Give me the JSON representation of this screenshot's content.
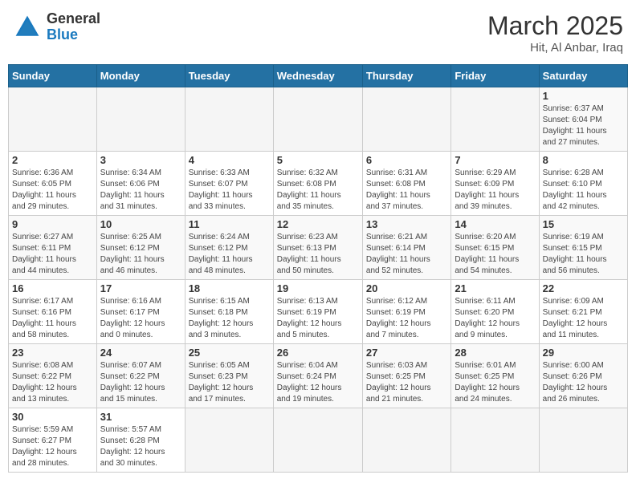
{
  "header": {
    "logo_general": "General",
    "logo_blue": "Blue",
    "title": "March 2025",
    "subtitle": "Hit, Al Anbar, Iraq"
  },
  "days_of_week": [
    "Sunday",
    "Monday",
    "Tuesday",
    "Wednesday",
    "Thursday",
    "Friday",
    "Saturday"
  ],
  "weeks": [
    [
      {
        "day": "",
        "info": ""
      },
      {
        "day": "",
        "info": ""
      },
      {
        "day": "",
        "info": ""
      },
      {
        "day": "",
        "info": ""
      },
      {
        "day": "",
        "info": ""
      },
      {
        "day": "",
        "info": ""
      },
      {
        "day": "1",
        "info": "Sunrise: 6:37 AM\nSunset: 6:04 PM\nDaylight: 11 hours\nand 27 minutes."
      }
    ],
    [
      {
        "day": "2",
        "info": "Sunrise: 6:36 AM\nSunset: 6:05 PM\nDaylight: 11 hours\nand 29 minutes."
      },
      {
        "day": "3",
        "info": "Sunrise: 6:34 AM\nSunset: 6:06 PM\nDaylight: 11 hours\nand 31 minutes."
      },
      {
        "day": "4",
        "info": "Sunrise: 6:33 AM\nSunset: 6:07 PM\nDaylight: 11 hours\nand 33 minutes."
      },
      {
        "day": "5",
        "info": "Sunrise: 6:32 AM\nSunset: 6:08 PM\nDaylight: 11 hours\nand 35 minutes."
      },
      {
        "day": "6",
        "info": "Sunrise: 6:31 AM\nSunset: 6:08 PM\nDaylight: 11 hours\nand 37 minutes."
      },
      {
        "day": "7",
        "info": "Sunrise: 6:29 AM\nSunset: 6:09 PM\nDaylight: 11 hours\nand 39 minutes."
      },
      {
        "day": "8",
        "info": "Sunrise: 6:28 AM\nSunset: 6:10 PM\nDaylight: 11 hours\nand 42 minutes."
      }
    ],
    [
      {
        "day": "9",
        "info": "Sunrise: 6:27 AM\nSunset: 6:11 PM\nDaylight: 11 hours\nand 44 minutes."
      },
      {
        "day": "10",
        "info": "Sunrise: 6:25 AM\nSunset: 6:12 PM\nDaylight: 11 hours\nand 46 minutes."
      },
      {
        "day": "11",
        "info": "Sunrise: 6:24 AM\nSunset: 6:12 PM\nDaylight: 11 hours\nand 48 minutes."
      },
      {
        "day": "12",
        "info": "Sunrise: 6:23 AM\nSunset: 6:13 PM\nDaylight: 11 hours\nand 50 minutes."
      },
      {
        "day": "13",
        "info": "Sunrise: 6:21 AM\nSunset: 6:14 PM\nDaylight: 11 hours\nand 52 minutes."
      },
      {
        "day": "14",
        "info": "Sunrise: 6:20 AM\nSunset: 6:15 PM\nDaylight: 11 hours\nand 54 minutes."
      },
      {
        "day": "15",
        "info": "Sunrise: 6:19 AM\nSunset: 6:15 PM\nDaylight: 11 hours\nand 56 minutes."
      }
    ],
    [
      {
        "day": "16",
        "info": "Sunrise: 6:17 AM\nSunset: 6:16 PM\nDaylight: 11 hours\nand 58 minutes."
      },
      {
        "day": "17",
        "info": "Sunrise: 6:16 AM\nSunset: 6:17 PM\nDaylight: 12 hours\nand 0 minutes."
      },
      {
        "day": "18",
        "info": "Sunrise: 6:15 AM\nSunset: 6:18 PM\nDaylight: 12 hours\nand 3 minutes."
      },
      {
        "day": "19",
        "info": "Sunrise: 6:13 AM\nSunset: 6:19 PM\nDaylight: 12 hours\nand 5 minutes."
      },
      {
        "day": "20",
        "info": "Sunrise: 6:12 AM\nSunset: 6:19 PM\nDaylight: 12 hours\nand 7 minutes."
      },
      {
        "day": "21",
        "info": "Sunrise: 6:11 AM\nSunset: 6:20 PM\nDaylight: 12 hours\nand 9 minutes."
      },
      {
        "day": "22",
        "info": "Sunrise: 6:09 AM\nSunset: 6:21 PM\nDaylight: 12 hours\nand 11 minutes."
      }
    ],
    [
      {
        "day": "23",
        "info": "Sunrise: 6:08 AM\nSunset: 6:22 PM\nDaylight: 12 hours\nand 13 minutes."
      },
      {
        "day": "24",
        "info": "Sunrise: 6:07 AM\nSunset: 6:22 PM\nDaylight: 12 hours\nand 15 minutes."
      },
      {
        "day": "25",
        "info": "Sunrise: 6:05 AM\nSunset: 6:23 PM\nDaylight: 12 hours\nand 17 minutes."
      },
      {
        "day": "26",
        "info": "Sunrise: 6:04 AM\nSunset: 6:24 PM\nDaylight: 12 hours\nand 19 minutes."
      },
      {
        "day": "27",
        "info": "Sunrise: 6:03 AM\nSunset: 6:25 PM\nDaylight: 12 hours\nand 21 minutes."
      },
      {
        "day": "28",
        "info": "Sunrise: 6:01 AM\nSunset: 6:25 PM\nDaylight: 12 hours\nand 24 minutes."
      },
      {
        "day": "29",
        "info": "Sunrise: 6:00 AM\nSunset: 6:26 PM\nDaylight: 12 hours\nand 26 minutes."
      }
    ],
    [
      {
        "day": "30",
        "info": "Sunrise: 5:59 AM\nSunset: 6:27 PM\nDaylight: 12 hours\nand 28 minutes."
      },
      {
        "day": "31",
        "info": "Sunrise: 5:57 AM\nSunset: 6:28 PM\nDaylight: 12 hours\nand 30 minutes."
      },
      {
        "day": "",
        "info": ""
      },
      {
        "day": "",
        "info": ""
      },
      {
        "day": "",
        "info": ""
      },
      {
        "day": "",
        "info": ""
      },
      {
        "day": "",
        "info": ""
      }
    ]
  ]
}
